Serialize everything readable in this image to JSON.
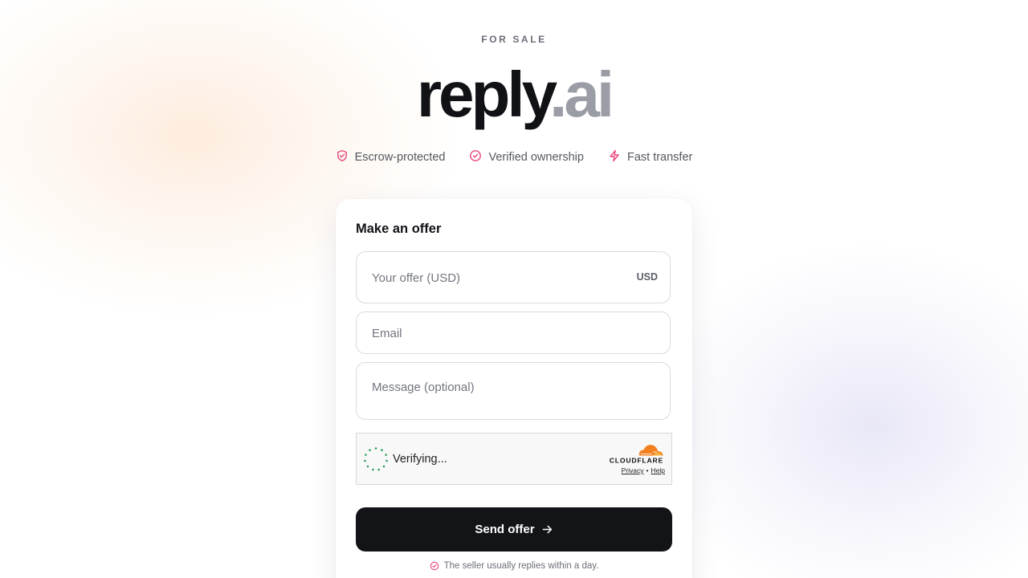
{
  "header": {
    "eyebrow": "FOR SALE",
    "domain_name": "reply",
    "domain_tld": ".ai"
  },
  "badges": [
    {
      "icon": "shield-icon",
      "label": "Escrow-protected"
    },
    {
      "icon": "check-badge-icon",
      "label": "Verified ownership"
    },
    {
      "icon": "lightning-icon",
      "label": "Fast transfer"
    }
  ],
  "offer_form": {
    "title": "Make an offer",
    "offer_placeholder": "Your offer (USD)",
    "offer_value": "",
    "currency_label": "USD",
    "email_placeholder": "Email",
    "email_value": "",
    "message_placeholder": "Message (optional)",
    "message_value": "",
    "captcha": {
      "status": "Verifying...",
      "brand": "CLOUDFLARE",
      "privacy_link": "Privacy",
      "separator": "•",
      "help_link": "Help"
    },
    "submit_label": "Send offer",
    "footnote": "The seller usually replies within a day."
  },
  "colors": {
    "accent_pink": "#e8457a",
    "button_bg": "#131418",
    "domain_tld": "#9a9ca6",
    "cloudflare_orange": "#f38020",
    "spinner_green": "#2f9c5c"
  }
}
